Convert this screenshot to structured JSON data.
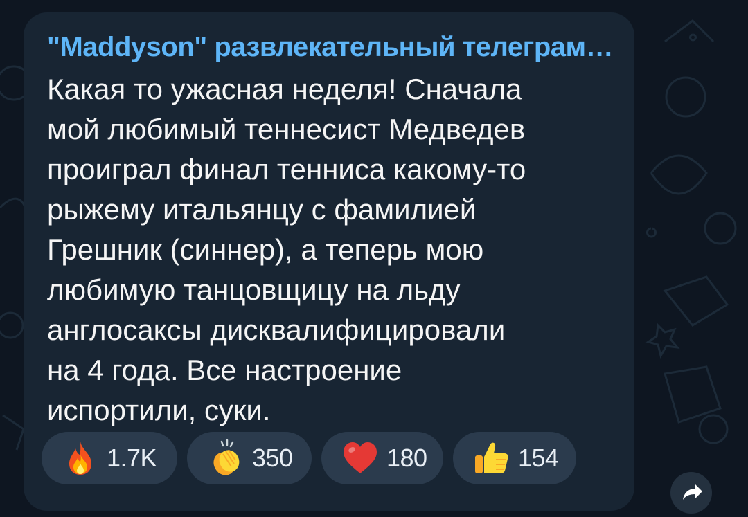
{
  "channel": {
    "name": "\"Maddyson\" развлекательный телеграм…"
  },
  "message": {
    "text": "Какая то ужасная неделя! Сначала\nмой любимый теннесист Медведев\nпроиграл финал тенниса какому-то\nрыжему итальянцу с фамилией\nГрешник (синнер), а теперь мою\nлюбимую танцовщицу на льду\nанглосаксы дисквалифицировали\nна 4 года. Все настроение\nиспортили, суки."
  },
  "reactions": [
    {
      "icon": "fire-emoji-icon",
      "count": "1.7K"
    },
    {
      "icon": "clapping-hands-emoji-icon",
      "count": "350"
    },
    {
      "icon": "red-heart-emoji-icon",
      "count": "180"
    },
    {
      "icon": "thumbs-up-emoji-icon",
      "count": "154"
    }
  ],
  "colors": {
    "background": "#0e1621",
    "bubble": "#182533",
    "channel_name": "#5eb5f7",
    "text": "#f5f5f5",
    "reaction_pill": "#2b3b4d"
  }
}
